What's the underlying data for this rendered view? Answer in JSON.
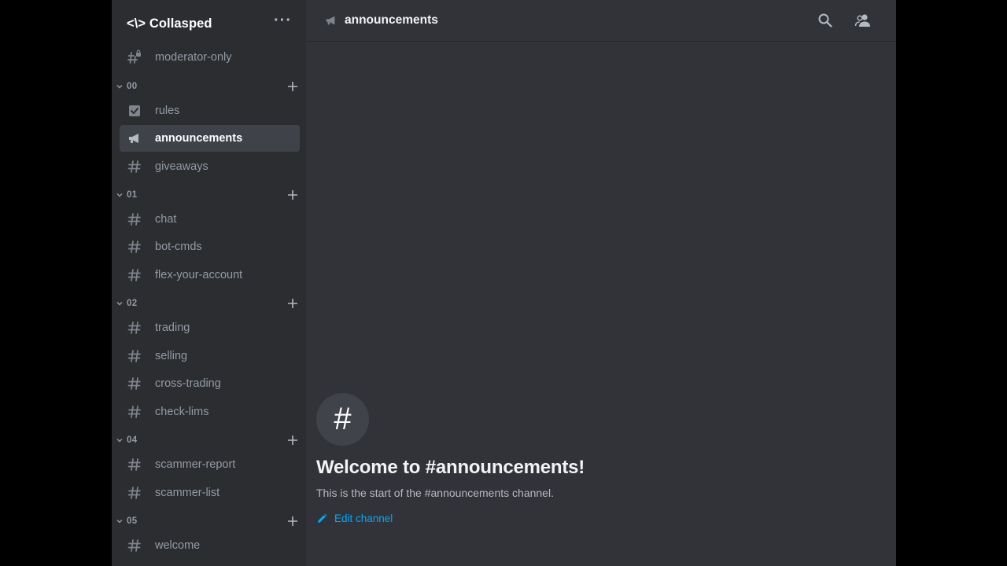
{
  "server": {
    "name": "<\\> Collasped"
  },
  "channel_list": {
    "top": [
      {
        "name": "moderator-only",
        "icon": "hash-lock-icon"
      }
    ],
    "categories": [
      {
        "name": "00",
        "channels": [
          {
            "name": "rules",
            "icon": "rules-checkbox-icon"
          },
          {
            "name": "announcements",
            "icon": "megaphone-icon",
            "selected": true
          },
          {
            "name": "giveaways",
            "icon": "hash-icon"
          }
        ]
      },
      {
        "name": "01",
        "channels": [
          {
            "name": "chat",
            "icon": "hash-icon"
          },
          {
            "name": "bot-cmds",
            "icon": "hash-icon"
          },
          {
            "name": "flex-your-account",
            "icon": "hash-icon"
          }
        ]
      },
      {
        "name": "02",
        "channels": [
          {
            "name": "trading",
            "icon": "hash-icon"
          },
          {
            "name": "selling",
            "icon": "hash-icon"
          },
          {
            "name": "cross-trading",
            "icon": "hash-icon"
          },
          {
            "name": "check-lims",
            "icon": "hash-icon"
          }
        ]
      },
      {
        "name": "04",
        "channels": [
          {
            "name": "scammer-report",
            "icon": "hash-icon"
          },
          {
            "name": "scammer-list",
            "icon": "hash-icon"
          }
        ]
      },
      {
        "name": "05",
        "channels": [
          {
            "name": "welcome",
            "icon": "hash-icon"
          }
        ]
      }
    ]
  },
  "topbar": {
    "channel_name": "announcements",
    "channel_icon": "megaphone-icon",
    "buttons": [
      "search-icon",
      "member-list-icon"
    ]
  },
  "welcome": {
    "avatar_glyph": "#",
    "title": "Welcome to #announcements!",
    "subtitle": "This is the start of the #announcements channel.",
    "edit_label": "Edit channel"
  },
  "colors": {
    "sidebar_bg": "#2b2d31",
    "main_bg": "#313338",
    "selected_bg": "#404249",
    "link": "#00a8fc",
    "muted_text": "#949ba4"
  }
}
